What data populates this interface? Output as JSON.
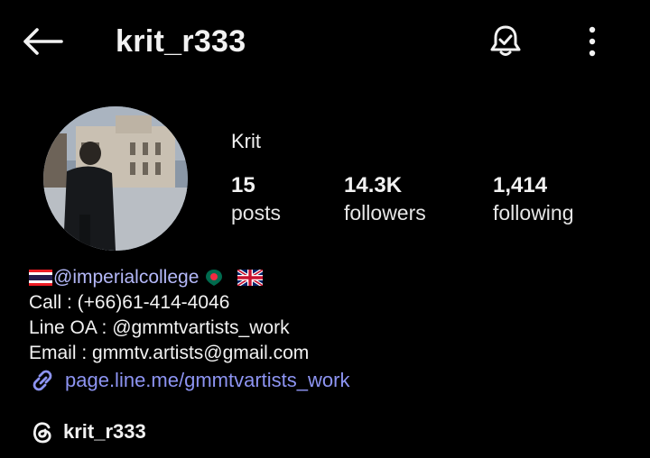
{
  "header": {
    "username": "krit_r333",
    "back_icon": "back-arrow-icon",
    "notifications_icon": "bell-check-icon",
    "more_icon": "more-vertical-icon"
  },
  "profile": {
    "display_name": "Krit",
    "stats": [
      {
        "value": "15",
        "label": "posts"
      },
      {
        "value": "14.3K",
        "label": "followers"
      },
      {
        "value": "1,414",
        "label": "following"
      }
    ]
  },
  "bio": {
    "mention": "@imperialcollege",
    "call": "Call : (+66)61-414-4046",
    "line_prefix": "Line OA : ",
    "line_handle": "@gmmtvartists_work",
    "email": "Email : gmmtv.artists@gmail.com",
    "link": "page.line.me/gmmtvartists_work"
  },
  "threads": {
    "handle": "krit_r333",
    "icon": "threads-icon"
  },
  "colors": {
    "background": "#000000",
    "text": "#f2f2f2",
    "link": "#8d94f2",
    "mention": "#b4b8f8"
  }
}
